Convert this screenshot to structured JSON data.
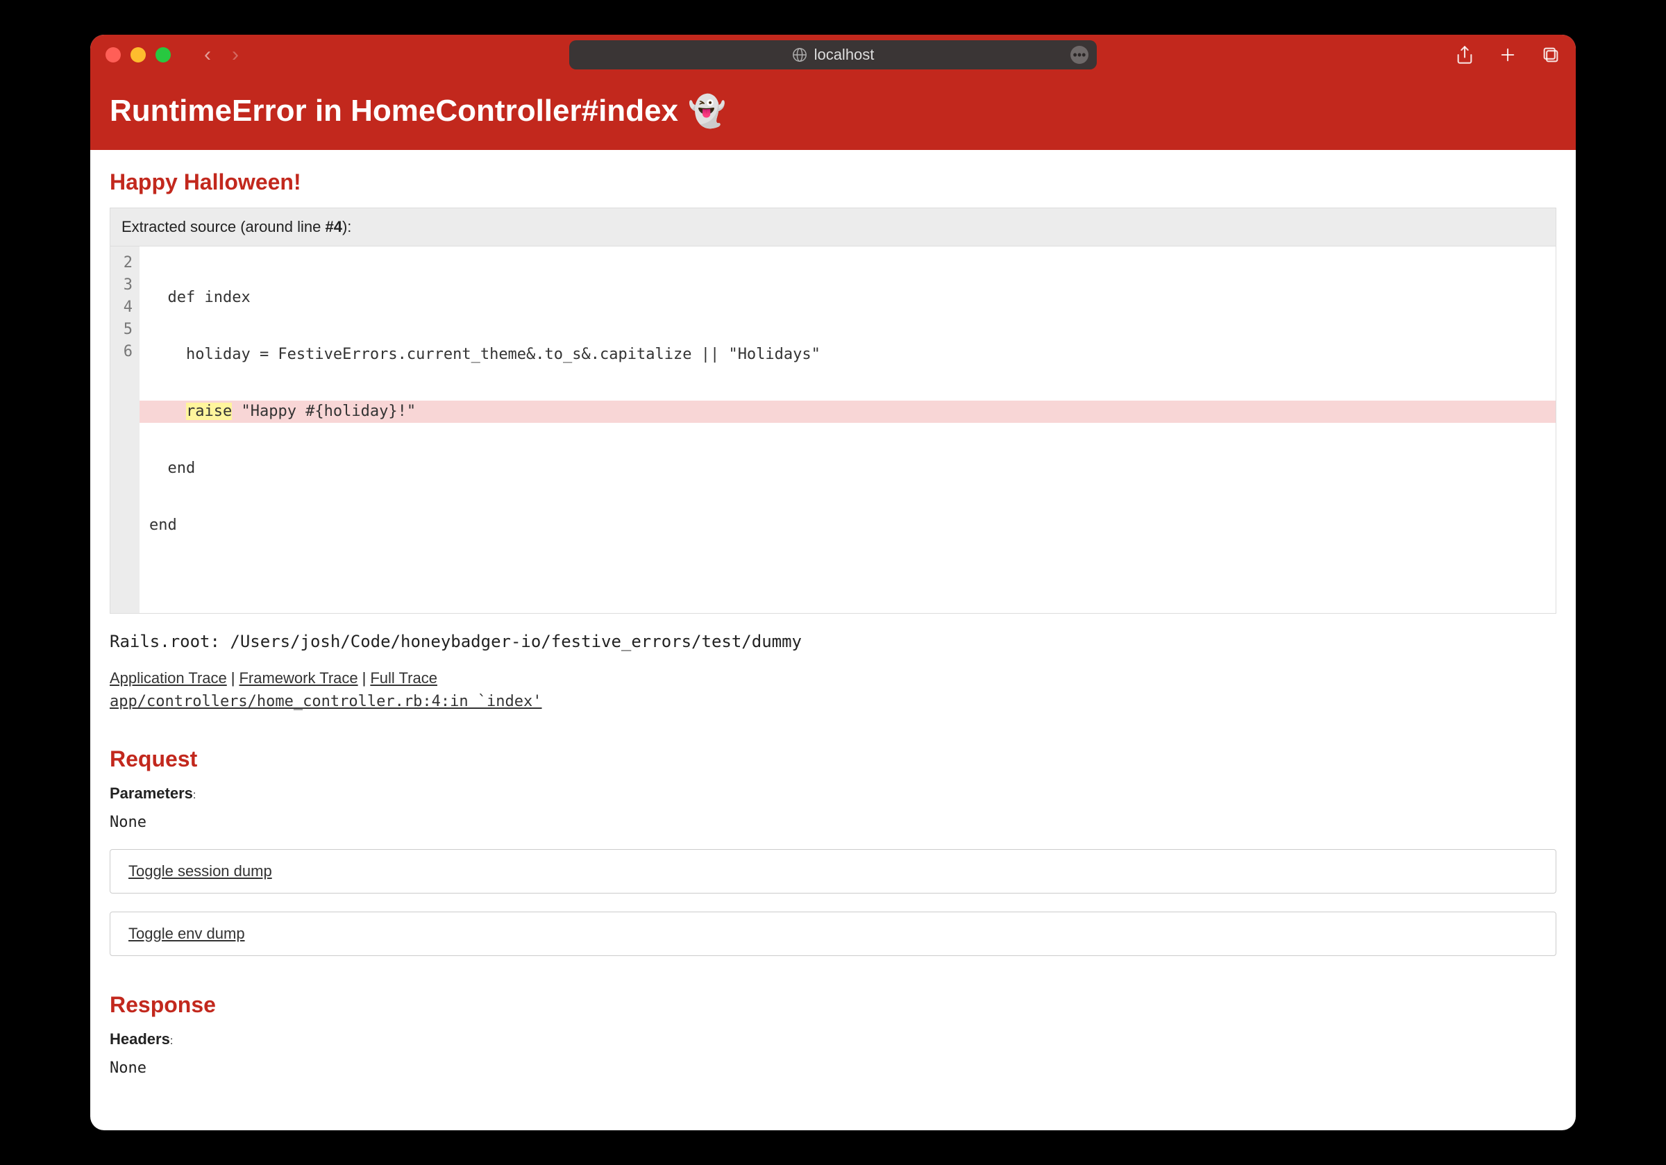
{
  "browser": {
    "url_host": "localhost"
  },
  "error": {
    "title": "RuntimeError in HomeController#index",
    "emoji": "👻",
    "message": "Happy Halloween!"
  },
  "source": {
    "banner_prefix": "Extracted source (around line ",
    "banner_line_label": "#4",
    "banner_suffix": "):",
    "lines": [
      {
        "num": "2",
        "text": "  def index"
      },
      {
        "num": "3",
        "text": "    holiday = FestiveErrors.current_theme&.to_s&.capitalize || \"Holidays\""
      },
      {
        "num": "4",
        "text_pre": "    ",
        "keyword": "raise",
        "text_post": " \"Happy #{holiday}!\"",
        "highlight": true
      },
      {
        "num": "5",
        "text": "  end"
      },
      {
        "num": "6",
        "text": "end"
      }
    ]
  },
  "rails_root": "Rails.root: /Users/josh/Code/honeybadger-io/festive_errors/test/dummy",
  "traces": {
    "app": "Application Trace",
    "framework": "Framework Trace",
    "full": "Full Trace",
    "file": "app/controllers/home_controller.rb:4:in `index'"
  },
  "request": {
    "heading": "Request",
    "params_label": "Parameters",
    "params_value": "None",
    "toggle_session": "Toggle session dump",
    "toggle_env": "Toggle env dump"
  },
  "response": {
    "heading": "Response",
    "headers_label": "Headers",
    "headers_value": "None"
  }
}
